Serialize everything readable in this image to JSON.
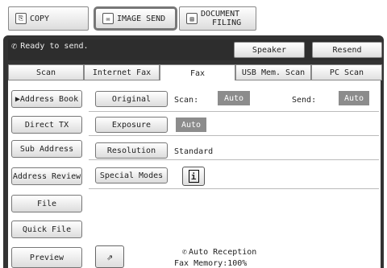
{
  "modes": [
    {
      "label": "COPY",
      "icon": "copy-icon"
    },
    {
      "label": "IMAGE SEND",
      "icon": "image-send-icon"
    },
    {
      "label_line1": "DOCUMENT",
      "label_line2": "FILING",
      "icon": "document-filing-icon"
    }
  ],
  "status": {
    "text": "Ready to send.",
    "icon": "phone-icon"
  },
  "buttons": {
    "speaker": "Speaker",
    "resend": "Resend"
  },
  "tabs": [
    "Scan",
    "Internet Fax",
    "Fax",
    "USB Mem. Scan",
    "PC Scan"
  ],
  "left_buttons": {
    "address_book": "▶Address Book",
    "direct_tx": "Direct TX",
    "sub_address": "Sub Address",
    "address_review": "Address Review",
    "file": "File",
    "quick_file": "Quick File",
    "preview": "Preview"
  },
  "settings": {
    "original": {
      "label": "Original",
      "scan_label": "Scan:",
      "scan_value": "Auto",
      "send_label": "Send:",
      "send_value": "Auto"
    },
    "exposure": {
      "label": "Exposure",
      "value": "Auto"
    },
    "resolution": {
      "label": "Resolution",
      "value": "Standard"
    },
    "special_modes": {
      "label": "Special Modes"
    }
  },
  "footer": {
    "reception": "Auto Reception",
    "memory": "Fax Memory:100%"
  },
  "colors": {
    "panel": "#333333",
    "gray_value": "#8c8c8c"
  }
}
